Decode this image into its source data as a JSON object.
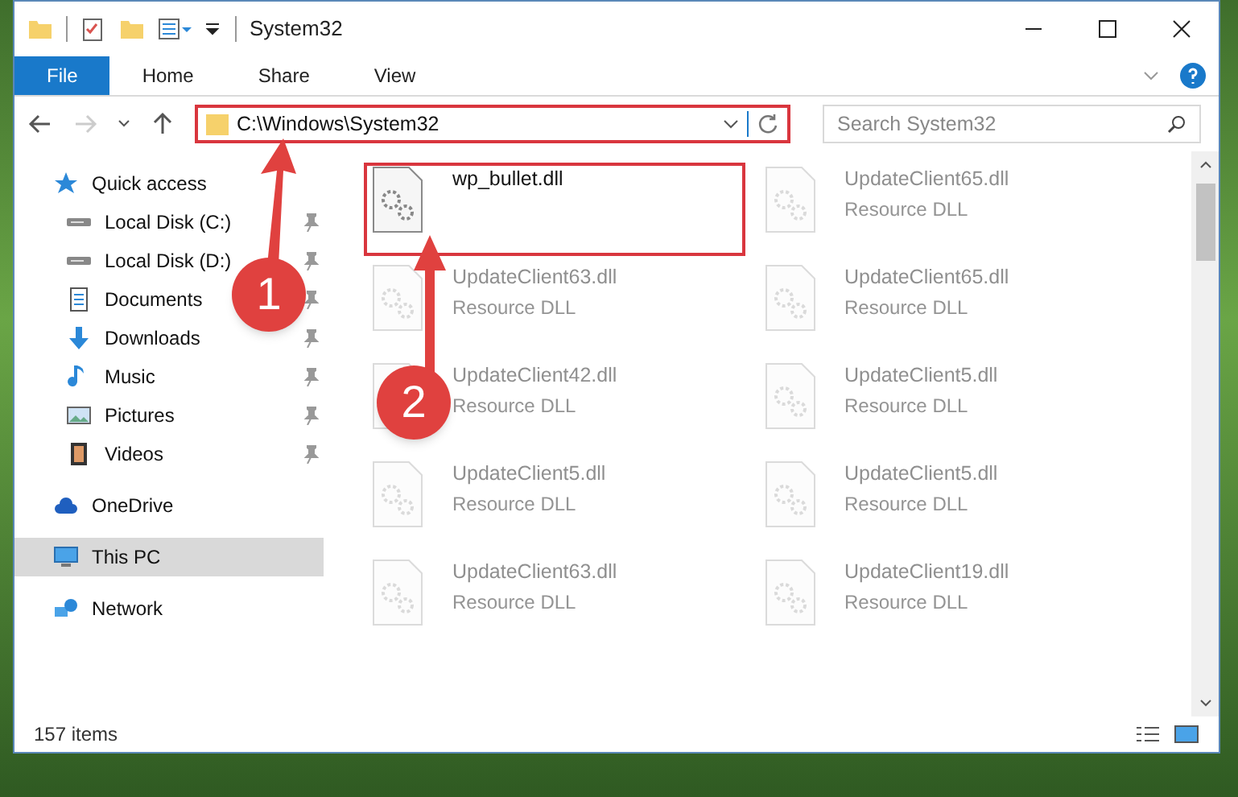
{
  "window": {
    "title": "System32"
  },
  "ribbon_tabs": [
    {
      "label": "File",
      "selected": true
    },
    {
      "label": "Home",
      "selected": false
    },
    {
      "label": "Share",
      "selected": false
    },
    {
      "label": "View",
      "selected": false
    }
  ],
  "address": {
    "value": "C:\\Windows\\System32"
  },
  "search": {
    "placeholder": "Search System32"
  },
  "sidebar": {
    "items": [
      {
        "label": "Quick access",
        "selected": false,
        "children": [
          {
            "label": "Local Disk (C:)",
            "pinned": true,
            "selected": false
          },
          {
            "label": "Local Disk (D:)",
            "pinned": true,
            "selected": false
          },
          {
            "label": "Documents",
            "pinned": true,
            "selected": false
          },
          {
            "label": "Downloads",
            "pinned": true,
            "selected": false
          },
          {
            "label": "Music",
            "pinned": true,
            "selected": false
          },
          {
            "label": "Pictures",
            "pinned": true,
            "selected": false
          },
          {
            "label": "Videos",
            "pinned": true,
            "selected": false
          }
        ]
      },
      {
        "label": "OneDrive",
        "selected": false
      },
      {
        "label": "This PC",
        "selected": true
      },
      {
        "label": "Network",
        "selected": false
      }
    ]
  },
  "files": [
    {
      "name": "wp_bullet.dll",
      "faded": false
    },
    {
      "name": "UpdateClient65.dll",
      "type": "Resource DLL",
      "faded": true
    },
    {
      "name": "UpdateClient63.dll",
      "type": "Resource DLL",
      "faded": true
    },
    {
      "name": "UpdateClient65.dll",
      "type": "Resource DLL",
      "faded": true
    },
    {
      "name": "UpdateClient42.dll",
      "type": "Resource DLL",
      "faded": true
    },
    {
      "name": "UpdateClient5.dll",
      "type": "Resource DLL",
      "faded": true
    },
    {
      "name": "UpdateClient5.dll",
      "type": "Resource DLL",
      "faded": true
    },
    {
      "name": "UpdateClient5.dll",
      "type": "Resource DLL",
      "faded": true
    },
    {
      "name": "UpdateClient63.dll",
      "type": "Resource DLL",
      "faded": true
    },
    {
      "name": "UpdateClient19.dll",
      "type": "Resource DLL",
      "faded": true
    }
  ],
  "status_bar": {
    "count": "157 items"
  },
  "annotations": [
    {
      "label": "1"
    },
    {
      "label": "2"
    }
  ]
}
